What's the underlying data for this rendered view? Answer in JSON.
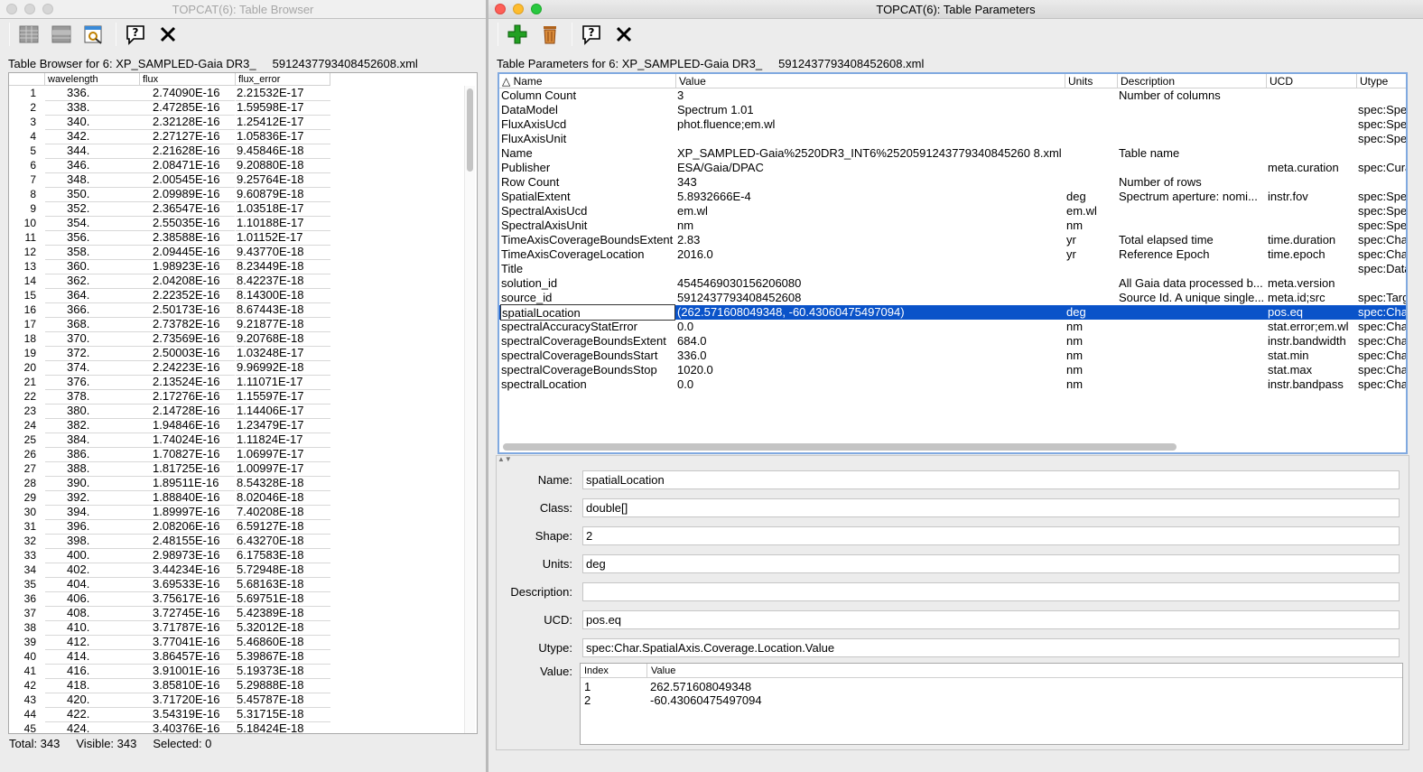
{
  "left_window": {
    "title": "TOPCAT(6): Table Browser",
    "toolbar": [
      "replace-table-icon",
      "highlight-rows-icon",
      "scroll-to-row-icon",
      "help-icon",
      "close-icon"
    ],
    "panel_title": "Table Browser for 6: XP_SAMPLED-Gaia DR3_     5912437793408452608.xml",
    "columns": [
      "wavelength",
      "flux",
      "flux_error"
    ],
    "rows": [
      [
        "1",
        "336.",
        "2.74090E-16",
        "2.21532E-17"
      ],
      [
        "2",
        "338.",
        "2.47285E-16",
        "1.59598E-17"
      ],
      [
        "3",
        "340.",
        "2.32128E-16",
        "1.25412E-17"
      ],
      [
        "4",
        "342.",
        "2.27127E-16",
        "1.05836E-17"
      ],
      [
        "5",
        "344.",
        "2.21628E-16",
        "9.45846E-18"
      ],
      [
        "6",
        "346.",
        "2.08471E-16",
        "9.20880E-18"
      ],
      [
        "7",
        "348.",
        "2.00545E-16",
        "9.25764E-18"
      ],
      [
        "8",
        "350.",
        "2.09989E-16",
        "9.60879E-18"
      ],
      [
        "9",
        "352.",
        "2.36547E-16",
        "1.03518E-17"
      ],
      [
        "10",
        "354.",
        "2.55035E-16",
        "1.10188E-17"
      ],
      [
        "11",
        "356.",
        "2.38588E-16",
        "1.01152E-17"
      ],
      [
        "12",
        "358.",
        "2.09445E-16",
        "9.43770E-18"
      ],
      [
        "13",
        "360.",
        "1.98923E-16",
        "8.23449E-18"
      ],
      [
        "14",
        "362.",
        "2.04208E-16",
        "8.42237E-18"
      ],
      [
        "15",
        "364.",
        "2.22352E-16",
        "8.14300E-18"
      ],
      [
        "16",
        "366.",
        "2.50173E-16",
        "8.67443E-18"
      ],
      [
        "17",
        "368.",
        "2.73782E-16",
        "9.21877E-18"
      ],
      [
        "18",
        "370.",
        "2.73569E-16",
        "9.20768E-18"
      ],
      [
        "19",
        "372.",
        "2.50003E-16",
        "1.03248E-17"
      ],
      [
        "20",
        "374.",
        "2.24223E-16",
        "9.96992E-18"
      ],
      [
        "21",
        "376.",
        "2.13524E-16",
        "1.11071E-17"
      ],
      [
        "22",
        "378.",
        "2.17276E-16",
        "1.15597E-17"
      ],
      [
        "23",
        "380.",
        "2.14728E-16",
        "1.14406E-17"
      ],
      [
        "24",
        "382.",
        "1.94846E-16",
        "1.23479E-17"
      ],
      [
        "25",
        "384.",
        "1.74024E-16",
        "1.11824E-17"
      ],
      [
        "26",
        "386.",
        "1.70827E-16",
        "1.06997E-17"
      ],
      [
        "27",
        "388.",
        "1.81725E-16",
        "1.00997E-17"
      ],
      [
        "28",
        "390.",
        "1.89511E-16",
        "8.54328E-18"
      ],
      [
        "29",
        "392.",
        "1.88840E-16",
        "8.02046E-18"
      ],
      [
        "30",
        "394.",
        "1.89997E-16",
        "7.40208E-18"
      ],
      [
        "31",
        "396.",
        "2.08206E-16",
        "6.59127E-18"
      ],
      [
        "32",
        "398.",
        "2.48155E-16",
        "6.43270E-18"
      ],
      [
        "33",
        "400.",
        "2.98973E-16",
        "6.17583E-18"
      ],
      [
        "34",
        "402.",
        "3.44234E-16",
        "5.72948E-18"
      ],
      [
        "35",
        "404.",
        "3.69533E-16",
        "5.68163E-18"
      ],
      [
        "36",
        "406.",
        "3.75617E-16",
        "5.69751E-18"
      ],
      [
        "37",
        "408.",
        "3.72745E-16",
        "5.42389E-18"
      ],
      [
        "38",
        "410.",
        "3.71787E-16",
        "5.32012E-18"
      ],
      [
        "39",
        "412.",
        "3.77041E-16",
        "5.46860E-18"
      ],
      [
        "40",
        "414.",
        "3.86457E-16",
        "5.39867E-18"
      ],
      [
        "41",
        "416.",
        "3.91001E-16",
        "5.19373E-18"
      ],
      [
        "42",
        "418.",
        "3.85810E-16",
        "5.29888E-18"
      ],
      [
        "43",
        "420.",
        "3.71720E-16",
        "5.45787E-18"
      ],
      [
        "44",
        "422.",
        "3.54319E-16",
        "5.31715E-18"
      ],
      [
        "45",
        "424.",
        "3.40376E-16",
        "5.18424E-18"
      ]
    ],
    "status": {
      "total": "Total: 343",
      "visible": "Visible: 343",
      "selected": "Selected: 0"
    }
  },
  "right_window": {
    "title": "TOPCAT(6): Table Parameters",
    "toolbar": [
      "add-parameter-icon",
      "delete-parameter-icon",
      "help-icon",
      "close-icon"
    ],
    "panel_title": "Table Parameters for 6: XP_SAMPLED-Gaia DR3_     5912437793408452608.xml",
    "columns": [
      "Name",
      "Value",
      "Units",
      "Description",
      "UCD",
      "Utype"
    ],
    "sort_indicator": "△",
    "rows": [
      [
        "Column Count",
        "3",
        "",
        "Number of columns",
        "",
        ""
      ],
      [
        "DataModel",
        "Spectrum 1.01",
        "",
        "",
        "",
        "spec:Spe"
      ],
      [
        "FluxAxisUcd",
        "phot.fluence;em.wl",
        "",
        "",
        "",
        "spec:Spe"
      ],
      [
        "FluxAxisUnit",
        "",
        "",
        "",
        "",
        "spec:Spe"
      ],
      [
        "Name",
        "XP_SAMPLED-Gaia%2520DR3_INT6%2520591243779340845260 8.xml",
        "",
        "Table name",
        "",
        ""
      ],
      [
        "Publisher",
        "ESA/Gaia/DPAC",
        "",
        "",
        "meta.curation",
        "spec:Cura"
      ],
      [
        "Row Count",
        "343",
        "",
        "Number of rows",
        "",
        ""
      ],
      [
        "SpatialExtent",
        "5.8932666E-4",
        "deg",
        "Spectrum aperture: nomi...",
        "instr.fov",
        "spec:Spe"
      ],
      [
        "SpectralAxisUcd",
        "em.wl",
        "em.wl",
        "",
        "",
        "spec:Spe"
      ],
      [
        "SpectralAxisUnit",
        "nm",
        "nm",
        "",
        "",
        "spec:Spe"
      ],
      [
        "TimeAxisCoverageBoundsExtent",
        "2.83",
        "yr",
        "Total elapsed time",
        "time.duration",
        "spec:Cha"
      ],
      [
        "TimeAxisCoverageLocation",
        "2016.0",
        "yr",
        "Reference Epoch",
        "time.epoch",
        "spec:Cha"
      ],
      [
        "Title",
        "",
        "",
        "",
        "",
        "spec:Data"
      ],
      [
        "solution_id",
        "4545469030156206080",
        "",
        "All Gaia data processed b...",
        "meta.version",
        ""
      ],
      [
        "source_id",
        "5912437793408452608",
        "",
        "Source Id. A unique single...",
        "meta.id;src",
        "spec:Targ"
      ],
      [
        "spatialLocation",
        "(262.571608049348, -60.43060475497094)",
        "deg",
        "",
        "pos.eq",
        "spec:Cha"
      ],
      [
        "spectralAccuracyStatError",
        "0.0",
        "nm",
        "",
        "stat.error;em.wl",
        "spec:Cha"
      ],
      [
        "spectralCoverageBoundsExtent",
        "684.0",
        "nm",
        "",
        "instr.bandwidth",
        "spec:Cha"
      ],
      [
        "spectralCoverageBoundsStart",
        "336.0",
        "nm",
        "",
        "stat.min",
        "spec:Cha"
      ],
      [
        "spectralCoverageBoundsStop",
        "1020.0",
        "nm",
        "",
        "stat.max",
        "spec:Cha"
      ],
      [
        "spectralLocation",
        "0.0",
        "nm",
        "",
        "instr.bandpass",
        "spec:Cha"
      ]
    ],
    "selected_row": 15,
    "splitter_arrows": "▲▼",
    "detail": {
      "name_label": "Name:",
      "name_value": "spatialLocation",
      "class_label": "Class:",
      "class_value": "double[]",
      "shape_label": "Shape:",
      "shape_value": "2",
      "units_label": "Units:",
      "units_value": "deg",
      "description_label": "Description:",
      "description_value": "",
      "ucd_label": "UCD:",
      "ucd_value": "pos.eq",
      "utype_label": "Utype:",
      "utype_value": "spec:Char.SpatialAxis.Coverage.Location.Value",
      "value_label": "Value:",
      "value_columns": [
        "Index",
        "Value"
      ],
      "value_rows": [
        [
          "1",
          "262.571608049348"
        ],
        [
          "2",
          "-60.43060475497094"
        ]
      ]
    }
  },
  "colors": {
    "selection": "#0a53c9",
    "focus_border": "#80a9e0"
  }
}
